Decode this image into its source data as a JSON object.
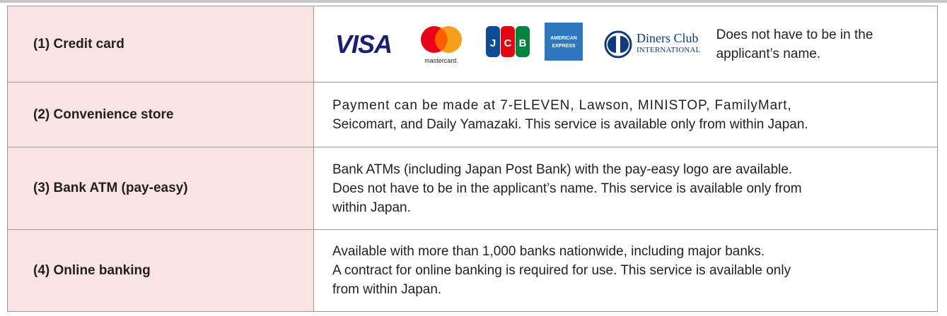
{
  "rows": [
    {
      "label": "(1) Credit card",
      "logos": {
        "visa": "VISA",
        "mastercard": "mastercard.",
        "jcb": "JCB",
        "amex_line1": "AMERICAN",
        "amex_line2": "EXPRESS",
        "diners_line1": "Diners Club",
        "diners_line2": "INTERNATIONAL"
      },
      "desc_lines": [
        "Does not have to be in the",
        "applicant’s name."
      ]
    },
    {
      "label": "(2) Convenience store",
      "desc_lines": [
        "Payment can be made at 7-ELEVEN, Lawson, MINISTOP, FamilyMart,",
        "Seicomart, and Daily Yamazaki. This service is available only from within Japan."
      ]
    },
    {
      "label": "(3) Bank ATM (pay-easy)",
      "desc_lines": [
        "Bank ATMs (including Japan Post Bank) with the pay-easy logo are available.",
        "Does not have to be in the applicant’s name. This service is available only from",
        "within Japan."
      ]
    },
    {
      "label": "(4) Online banking",
      "desc_lines": [
        "Available with more than 1,000 banks nationwide, including major banks.",
        "A contract for online banking is required for use. This service is available only",
        "from within Japan."
      ]
    }
  ],
  "colors": {
    "label_bg": "#f9e4e2",
    "border": "#9a9a9a",
    "text": "#231f20",
    "visa_blue": "#1a1f71",
    "mc_red": "#eb001b",
    "mc_orange": "#f79e1b",
    "jcb_blue": "#0e4c96",
    "jcb_red": "#e20613",
    "jcb_green": "#00843d",
    "amex_blue": "#2e77bc",
    "diners_blue": "#0f3b7c"
  }
}
